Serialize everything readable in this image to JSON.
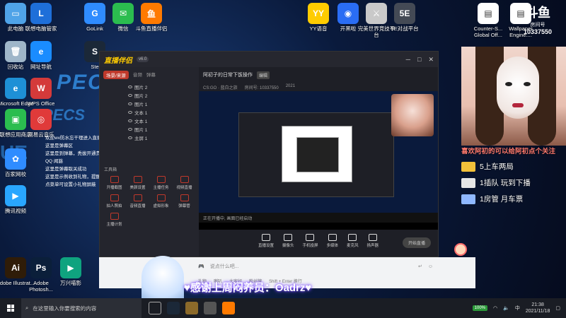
{
  "desktop_icons": [
    {
      "label": "此电脑",
      "color": "#4fa3e8",
      "sym": "▭"
    },
    {
      "label": "联想电脑管家",
      "color": "#1e6fd9",
      "sym": "L"
    },
    {
      "label": "GoLink",
      "color": "#2f8cff",
      "sym": "G"
    },
    {
      "label": "微信",
      "color": "#2bbd4f",
      "sym": "✉"
    },
    {
      "label": "斗鱼直播伴侣",
      "color": "#ff7a00",
      "sym": "鱼"
    },
    {
      "label": "YY语音",
      "color": "#ffcc00",
      "sym": "YY"
    },
    {
      "label": "开黑啦",
      "color": "#2a6df4",
      "sym": "◉"
    },
    {
      "label": "完美世界竞技平台",
      "color": "#c9c9c9",
      "sym": "⚔"
    },
    {
      "label": "5E对战平台",
      "color": "#444a55",
      "sym": "5E"
    },
    {
      "label": "Counter-S... Global Off...",
      "color": "#ffffff",
      "sym": "▤"
    },
    {
      "label": "Wallpaper Engine:...",
      "color": "#ffffff",
      "sym": "▤"
    },
    {
      "label": "回收站",
      "color": "#9fb6c9",
      "sym": "🗑"
    },
    {
      "label": "网址导航",
      "color": "#1a8cff",
      "sym": "e"
    },
    {
      "label": "Ste",
      "color": "#1b2838",
      "sym": "S"
    },
    {
      "label": "Microsoft Edge",
      "color": "#1e90d6",
      "sym": "e"
    },
    {
      "label": "WPS Office",
      "color": "#d43a3a",
      "sym": "W"
    },
    {
      "label": "联想应用商店",
      "color": "#2bbd4f",
      "sym": "▣"
    },
    {
      "label": "网易云音乐",
      "color": "#e03a3a",
      "sym": "◎"
    },
    {
      "label": "百家网校",
      "color": "#2f8cff",
      "sym": "✿"
    },
    {
      "label": "腾讯视频",
      "color": "#29a6ff",
      "sym": "▶"
    },
    {
      "label": "Adobe Illustrat...",
      "color": "#2f1c08",
      "sym": "Ai"
    },
    {
      "label": "Adobe Photosh...",
      "color": "#0b1f3a",
      "sym": "Ps"
    },
    {
      "label": "万兴喵影",
      "color": "#0fa37f",
      "sym": "▶"
    }
  ],
  "background_text": {
    "pecs1": "PECS",
    "pecs2": "PECS",
    "ue": "UE"
  },
  "chat_feed": [
    "欢迎wv防水忘干理进入直播间",
    "这里是弹幕区",
    "这里是到弹幕，秃拔开通贵族",
    "QQ 闻豁",
    "这里是弹幕取关成功",
    "这里是示例收到礼物，提醒",
    "点菜单可设置小礼物屏蔽"
  ],
  "app": {
    "logo": "直播伴侣",
    "version": "v6.0",
    "tabs": [
      "场景/来源",
      "音频",
      "弹幕"
    ],
    "scenes": [
      "图片 2",
      "图片 2",
      "图片 1",
      "文本 1",
      "文本 1",
      "图片 1",
      "主屏 1"
    ],
    "tools_title": "工具箱",
    "tools": [
      "开播截图",
      "美颜设置",
      "主播任务",
      "视频直播",
      "拍人照拍",
      "音频直播",
      "虚拟形象",
      "弹幕管",
      "主播计划"
    ],
    "main_title": "阿初子的日常下饭操作",
    "main_badge": "编辑",
    "main_sub": [
      "CS:GO · 蓝白之旅",
      "房间号: 10337550",
      "2021"
    ],
    "bottom_tools": [
      "直播设置",
      "摄像头",
      "手机投屏",
      "多媒体",
      "麦克风",
      "扬声器"
    ],
    "live_button": "开始直播",
    "preview_bar": "正在开播中, 画面已经启动"
  },
  "chat_window": {
    "placeholder": "说点什么吧...",
    "bottom_items": [
      "礼物",
      "喇叭",
      "大家好",
      "粉丝牌",
      "Shift + Enter 换行"
    ]
  },
  "logo_corner": {
    "big": "斗鱼",
    "small": "房间号",
    "room": "10337550"
  },
  "promo": {
    "title": "喜欢阿初的可以给阿初点个关注",
    "items": [
      {
        "text": "5上车两局",
        "color": "#f3c13a"
      },
      {
        "text": "1插队 玩到下播",
        "color": "#e6e6e6"
      },
      {
        "text": "1房管 月车票",
        "color": "#8fb8ff"
      }
    ]
  },
  "subscriber_banner": "♥感谢上周闷养员：Oadrz♥",
  "taskbar": {
    "search_placeholder": "在这里输入你要搜索的内容",
    "battery": "100%",
    "ime": "中",
    "time": "21:38",
    "date": "2021/11/18"
  }
}
